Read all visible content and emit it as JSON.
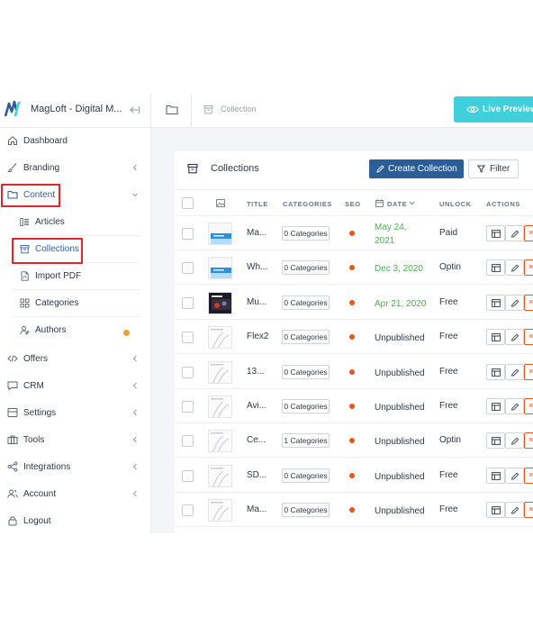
{
  "app": {
    "brand_name": "MagLoft - Digital M..."
  },
  "sidebar": {
    "items": [
      {
        "key": "dashboard",
        "label": "Dashboard",
        "icon": "home-icon"
      },
      {
        "key": "branding",
        "label": "Branding",
        "icon": "brush-icon",
        "has_chevron": true
      },
      {
        "key": "content",
        "label": "Content",
        "icon": "folder-icon",
        "expanded": true,
        "active": true
      },
      {
        "key": "offers",
        "label": "Offers",
        "icon": "code-icon",
        "has_chevron": true
      },
      {
        "key": "crm",
        "label": "CRM",
        "icon": "chat-icon",
        "has_chevron": true
      },
      {
        "key": "settings",
        "label": "Settings",
        "icon": "settings-icon",
        "has_chevron": true
      },
      {
        "key": "tools",
        "label": "Tools",
        "icon": "toolbox-icon",
        "has_chevron": true
      },
      {
        "key": "integrations",
        "label": "Integrations",
        "icon": "share-icon",
        "has_chevron": true
      },
      {
        "key": "account",
        "label": "Account",
        "icon": "users-icon",
        "has_chevron": true
      },
      {
        "key": "logout",
        "label": "Logout",
        "icon": "lock-icon"
      }
    ],
    "content_children": [
      {
        "key": "articles",
        "label": "Articles",
        "icon": "articles-icon"
      },
      {
        "key": "collections",
        "label": "Collections",
        "icon": "archive-icon",
        "active": true
      },
      {
        "key": "import_pdf",
        "label": "Import PDF",
        "icon": "pdf-icon"
      },
      {
        "key": "categories",
        "label": "Categories",
        "icon": "grid-icon"
      },
      {
        "key": "authors",
        "label": "Authors",
        "icon": "authors-icon",
        "badge_color": "#f0a12b"
      }
    ]
  },
  "header": {
    "breadcrumb": "Collection",
    "live_preview_label": "Live Preview"
  },
  "collections": {
    "title": "Collections",
    "create_label": "Create Collection",
    "filter_label": "Filter",
    "columns": {
      "title": "TITLE",
      "categories": "CATEGORIES",
      "seo": "SEO",
      "date": "DATE",
      "unlock": "UNLOCK",
      "actions": "ACTIONS"
    },
    "rows": [
      {
        "title": "Ma...",
        "categories": "0 Categories",
        "date": "May 24,",
        "date2": "2021",
        "date_published": true,
        "unlock": "Paid",
        "thumb": "blue"
      },
      {
        "title": "Wh...",
        "categories": "0 Categories",
        "date": "Dec 3, 2020",
        "date2": "",
        "date_published": true,
        "unlock": "Optin",
        "thumb": "blue"
      },
      {
        "title": "Mu...",
        "categories": "0 Categories",
        "date": "Apr 21, 2020",
        "date2": "",
        "date_published": true,
        "unlock": "Free",
        "thumb": "dark"
      },
      {
        "title": "Flex2",
        "categories": "0 Categories",
        "date": "Unpublished",
        "date2": "",
        "date_published": false,
        "unlock": "Free",
        "thumb": "blank"
      },
      {
        "title": "13...",
        "categories": "0 Categories",
        "date": "Unpublished",
        "date2": "",
        "date_published": false,
        "unlock": "Free",
        "thumb": "blank"
      },
      {
        "title": "Avi...",
        "categories": "0 Categories",
        "date": "Unpublished",
        "date2": "",
        "date_published": false,
        "unlock": "Free",
        "thumb": "blank"
      },
      {
        "title": "Ce...",
        "categories": "1 Categories",
        "date": "Unpublished",
        "date2": "",
        "date_published": false,
        "unlock": "Optin",
        "thumb": "blank"
      },
      {
        "title": "SD...",
        "categories": "0 Categories",
        "date": "Unpublished",
        "date2": "",
        "date_published": false,
        "unlock": "Free",
        "thumb": "blank"
      },
      {
        "title": "Ma...",
        "categories": "0 Categories",
        "date": "Unpublished",
        "date2": "",
        "date_published": false,
        "unlock": "Free",
        "thumb": "blank"
      }
    ]
  },
  "colors": {
    "accent_blue": "#2b5d96",
    "live_preview": "#3fd0dc",
    "seo_dot": "#e8551f",
    "published_date": "#4cb04f",
    "highlight_box": "#e0262a"
  }
}
